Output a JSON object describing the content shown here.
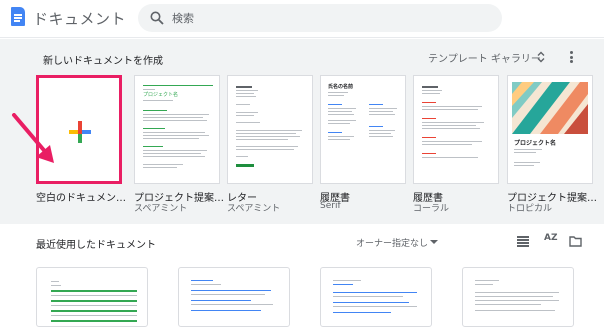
{
  "header": {
    "app_title": "ドキュメント",
    "search_placeholder": "検索"
  },
  "templates": {
    "section_title": "新しいドキュメントを作成",
    "gallery_label": "テンプレート ギャラリー",
    "items": [
      {
        "name": "空白のドキュメン…",
        "subtitle": ""
      },
      {
        "name": "プロジェクト提案…",
        "subtitle": "スペアミント"
      },
      {
        "name": "レター",
        "subtitle": "スペアミント"
      },
      {
        "name": "履歴書",
        "subtitle": "Serif"
      },
      {
        "name": "履歴書",
        "subtitle": "コーラル"
      },
      {
        "name": "プロジェクト提案…",
        "subtitle": "トロピカル"
      }
    ],
    "thumb_text": {
      "proposal_heading": "プロジェクト名",
      "resume_heading": "氏名の名前",
      "tropical_heading": "プロジェクト名"
    }
  },
  "recent": {
    "section_title": "最近使用したドキュメント",
    "owner_filter": "オーナー指定なし",
    "sort_label": "AZ"
  },
  "colors": {
    "accent_pink": "#e91e63",
    "docs_blue": "#4285f4",
    "spearmint": "#34a853",
    "coral": "#ea4335",
    "tropical_teal": "#26a69a"
  }
}
